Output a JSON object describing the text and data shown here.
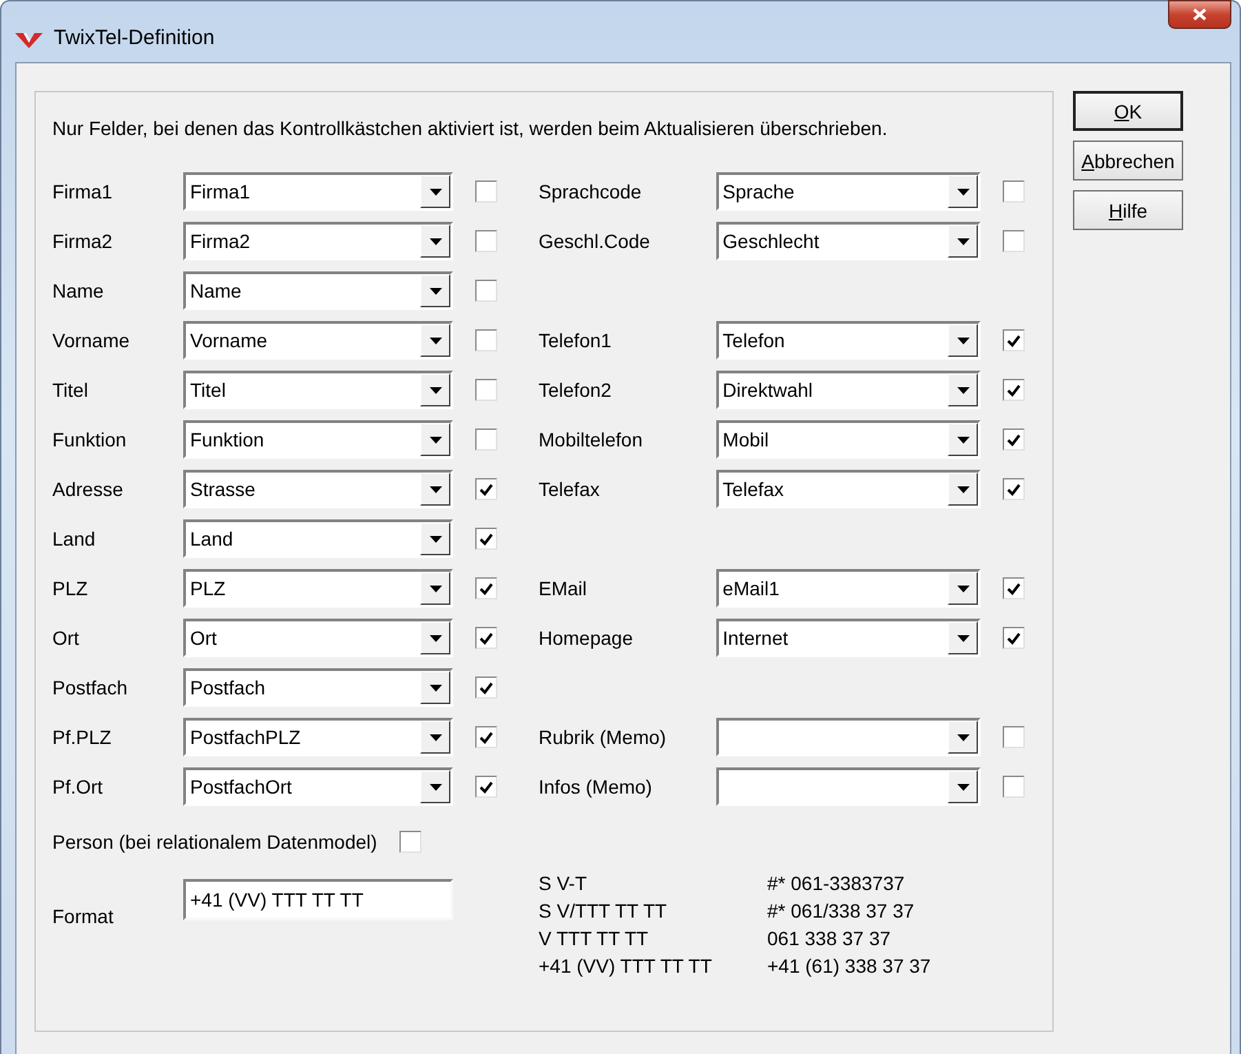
{
  "window": {
    "title": "TwixTel-Definition"
  },
  "intro": "Nur Felder, bei denen das Kontrollkästchen aktiviert ist, werden beim Aktualisieren überschrieben.",
  "rows": [
    {
      "left": {
        "label": "Firma1",
        "value": "Firma1",
        "checked": false
      },
      "right": {
        "label": "Sprachcode",
        "value": "Sprache",
        "checked": false
      }
    },
    {
      "left": {
        "label": "Firma2",
        "value": "Firma2",
        "checked": false
      },
      "right": {
        "label": "Geschl.Code",
        "value": "Geschlecht",
        "checked": false
      }
    },
    {
      "left": {
        "label": "Name",
        "value": "Name",
        "checked": false
      }
    },
    {
      "left": {
        "label": "Vorname",
        "value": "Vorname",
        "checked": false
      },
      "right": {
        "label": "Telefon1",
        "value": "Telefon",
        "checked": true
      }
    },
    {
      "left": {
        "label": "Titel",
        "value": "Titel",
        "checked": false
      },
      "right": {
        "label": "Telefon2",
        "value": "Direktwahl",
        "checked": true
      }
    },
    {
      "left": {
        "label": "Funktion",
        "value": "Funktion",
        "checked": false
      },
      "right": {
        "label": "Mobiltelefon",
        "value": "Mobil",
        "checked": true
      }
    },
    {
      "left": {
        "label": "Adresse",
        "value": "Strasse",
        "checked": true
      },
      "right": {
        "label": "Telefax",
        "value": "Telefax",
        "checked": true
      }
    },
    {
      "left": {
        "label": "Land",
        "value": "Land",
        "checked": true
      }
    },
    {
      "left": {
        "label": "PLZ",
        "value": "PLZ",
        "checked": true
      },
      "right": {
        "label": "EMail",
        "value": "eMail1",
        "checked": true
      }
    },
    {
      "left": {
        "label": "Ort",
        "value": "Ort",
        "checked": true
      },
      "right": {
        "label": "Homepage",
        "value": "Internet",
        "checked": true
      }
    },
    {
      "left": {
        "label": "Postfach",
        "value": "Postfach",
        "checked": true
      }
    },
    {
      "left": {
        "label": "Pf.PLZ",
        "value": "PostfachPLZ",
        "checked": true
      },
      "right": {
        "label": "Rubrik (Memo)",
        "checked": false
      }
    },
    {
      "left": {
        "label": "Pf.Ort",
        "value": "PostfachOrt",
        "checked": true
      },
      "right": {
        "label": "Infos (Memo)",
        "checked": false
      }
    }
  ],
  "person": {
    "label": "Person (bei relationalem Datenmodel)",
    "checked": false
  },
  "format": {
    "label": "Format",
    "value": "+41 (VV) TTT TT TT"
  },
  "examples": [
    {
      "pattern": "S V-T",
      "sample": "#* 061-3383737"
    },
    {
      "pattern": "S V/TTT TT TT",
      "sample": "#* 061/338 37 37"
    },
    {
      "pattern": "V TTT TT TT",
      "sample": "061 338 37 37"
    },
    {
      "pattern": "+41 (VV) TTT TT TT",
      "sample": "+41 (61) 338 37 37"
    }
  ],
  "buttons": [
    {
      "label": "OK",
      "default": true
    },
    {
      "label": "Abbrechen",
      "default": false
    },
    {
      "label": "Hilfe",
      "default": false
    }
  ]
}
